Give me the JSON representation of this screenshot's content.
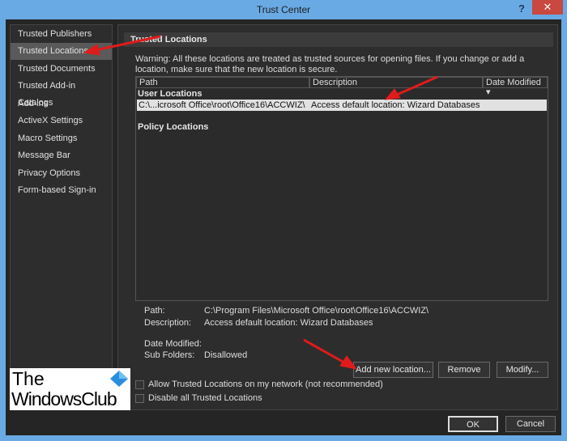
{
  "window": {
    "title": "Trust Center",
    "help": "?",
    "close": "✕"
  },
  "sidebar": {
    "items": [
      {
        "label": "Trusted Publishers"
      },
      {
        "label": "Trusted Locations",
        "selected": true
      },
      {
        "label": "Trusted Documents"
      },
      {
        "label": "Trusted Add-in Catalogs"
      },
      {
        "label": "Add-ins"
      },
      {
        "label": "ActiveX Settings"
      },
      {
        "label": "Macro Settings"
      },
      {
        "label": "Message Bar"
      },
      {
        "label": "Privacy Options"
      },
      {
        "label": "Form-based Sign-in"
      }
    ]
  },
  "main": {
    "header": "Trusted Locations",
    "warning": "Warning: All these locations are treated as trusted sources for opening files.  If you change or add a location, make sure that the new location is secure.",
    "table": {
      "columns": [
        "Path",
        "Description",
        "Date Modified ▾"
      ],
      "user_group": "User Locations",
      "rows": [
        {
          "path": "C:\\...icrosoft Office\\root\\Office16\\ACCWIZ\\",
          "description": "Access default location: Wizard Databases",
          "date": ""
        }
      ],
      "policy_group": "Policy Locations"
    },
    "details": {
      "path_label": "Path:",
      "path": "C:\\Program Files\\Microsoft Office\\root\\Office16\\ACCWIZ\\",
      "desc_label": "Description:",
      "desc": "Access default location: Wizard Databases",
      "date_label": "Date Modified:",
      "sub_label": "Sub Folders:",
      "sub": "Disallowed"
    },
    "buttons": {
      "add": "Add new location...",
      "remove": "Remove",
      "modify": "Modify..."
    },
    "checkboxes": [
      {
        "label": "Allow Trusted Locations on my network (not recommended)",
        "checked": false
      },
      {
        "label": "Disable all Trusted Locations",
        "checked": false
      }
    ]
  },
  "footer": {
    "ok": "OK",
    "cancel": "Cancel"
  },
  "watermark": {
    "line1": "The",
    "line2": "WindowsClub"
  },
  "colors": {
    "titlebar": "#6aaae4",
    "close": "#c9483f",
    "arrow": "#e01b1b"
  }
}
